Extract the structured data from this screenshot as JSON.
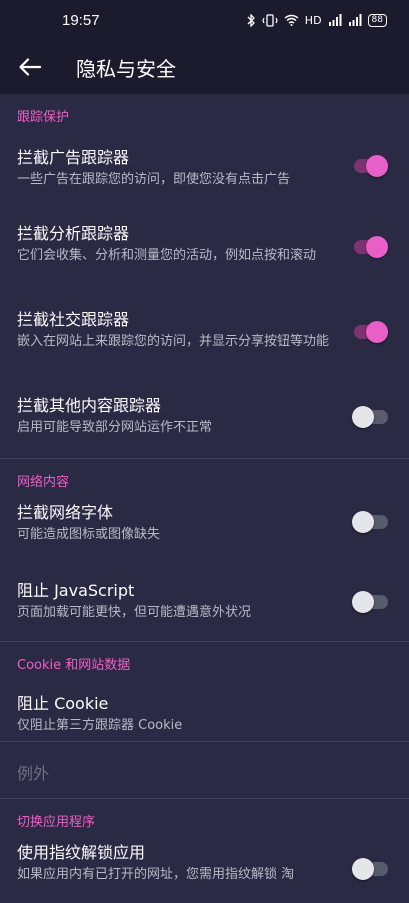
{
  "status_bar": {
    "time": "19:57",
    "network_label": "HD",
    "battery": "88",
    "icons": [
      "bluetooth-icon",
      "vibrate-icon",
      "wifi-icon",
      "signal-icon",
      "signal-icon",
      "battery-icon"
    ]
  },
  "app_bar": {
    "back_icon": "arrow-left-icon",
    "title": "隐私与安全"
  },
  "sections": {
    "tracking": {
      "header": "跟踪保护",
      "items": [
        {
          "title": "拦截广告跟踪器",
          "subtitle": "一些广告在跟踪您的访问，即使您没有点击广告",
          "toggle_on": true
        },
        {
          "title": "拦截分析跟踪器",
          "subtitle": "它们会收集、分析和测量您的活动，例如点按和滚动",
          "toggle_on": true
        },
        {
          "title": "拦截社交跟踪器",
          "subtitle": "嵌入在网站上来跟踪您的访问，并显示分享按钮等功能",
          "toggle_on": true
        },
        {
          "title": "拦截其他内容跟踪器",
          "subtitle": "启用可能导致部分网站运作不正常",
          "toggle_on": false
        }
      ]
    },
    "network": {
      "header": "网络内容",
      "items": [
        {
          "title": "拦截网络字体",
          "subtitle": "可能造成图标或图像缺失",
          "toggle_on": false
        },
        {
          "title": "阻止 JavaScript",
          "subtitle": "页面加载可能更快，但可能遭遇意外状况",
          "toggle_on": false
        }
      ]
    },
    "cookie": {
      "header": "Cookie 和网站数据",
      "items": [
        {
          "title": "阻止 Cookie",
          "subtitle": "仅阻止第三方跟踪器 Cookie"
        }
      ],
      "exceptions_label": "例外"
    },
    "switch_apps": {
      "header": "切换应用程序",
      "items": [
        {
          "title": "使用指纹解锁应用",
          "subtitle": "如果应用内有已打开的网址，您需用指纹解锁 淘",
          "toggle_on": false
        }
      ]
    }
  },
  "colors": {
    "accent": "#ed5fc6",
    "background": "#2a2a44",
    "bar": "#1c1b2e"
  }
}
